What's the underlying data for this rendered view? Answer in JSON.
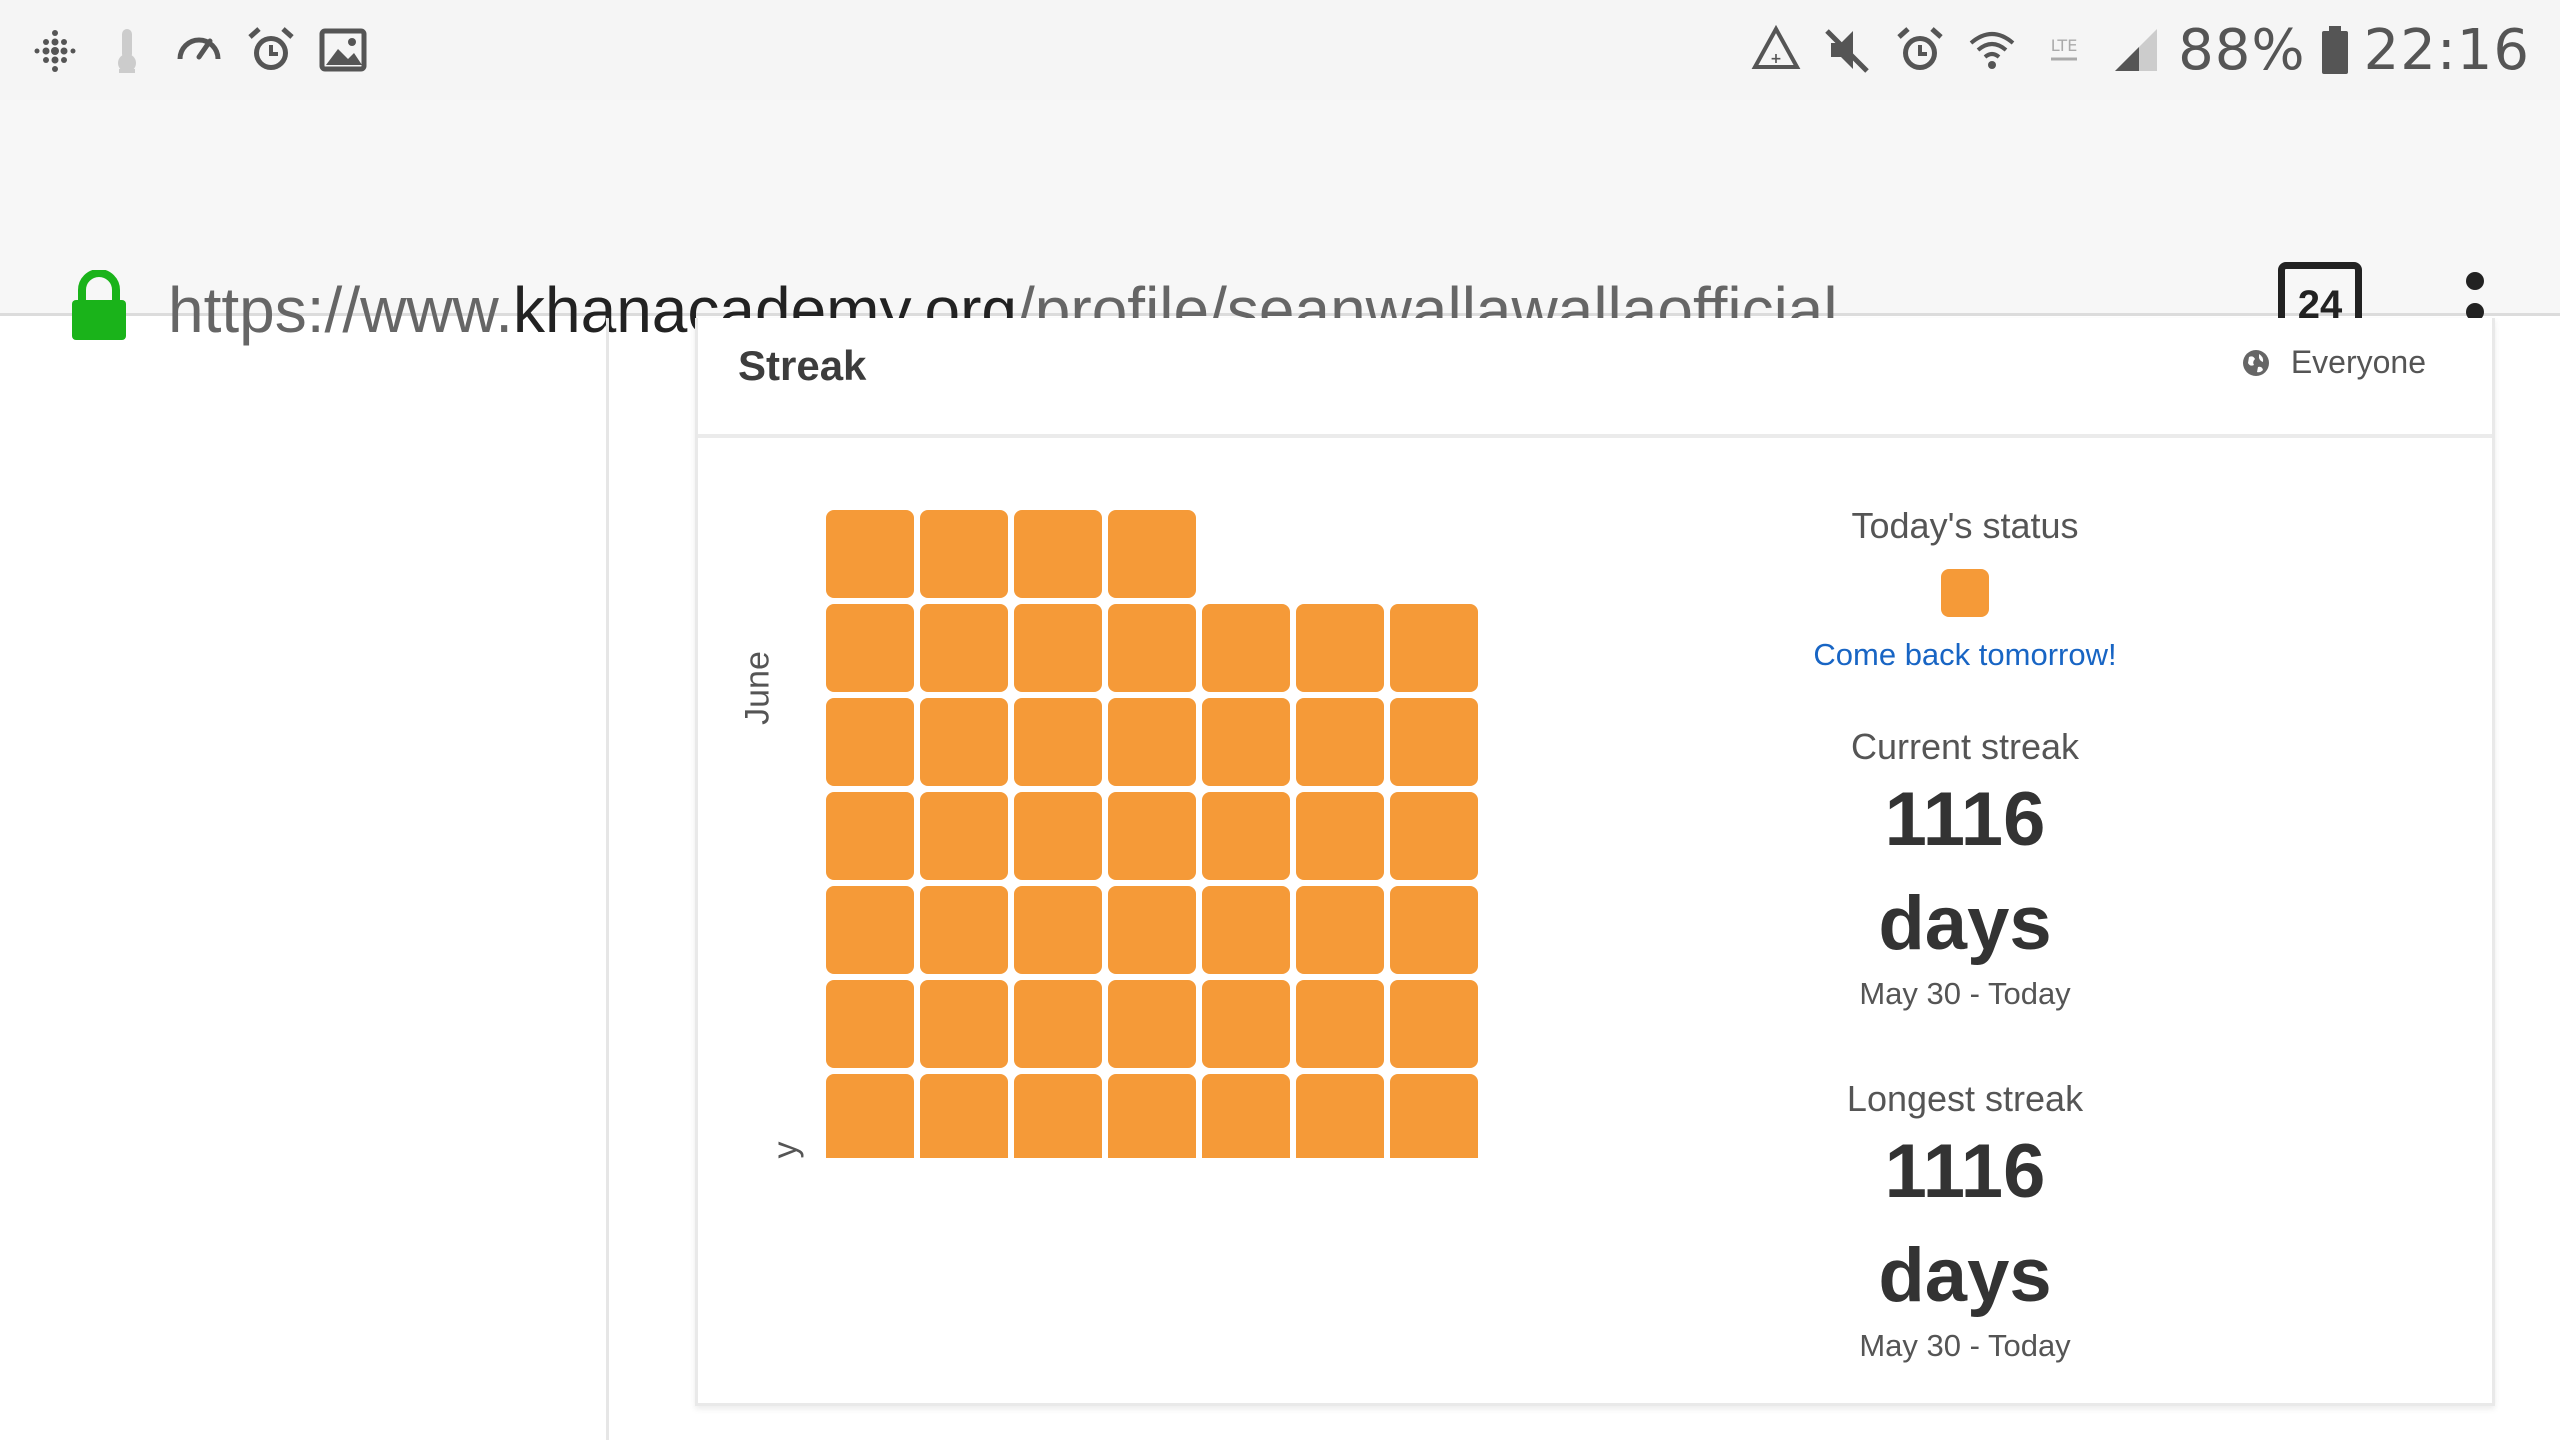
{
  "status_bar": {
    "left_icons": [
      "fitbit-icon",
      "thermometer-icon",
      "speedometer-icon",
      "alarm-icon",
      "gallery-icon"
    ],
    "right_icons": [
      "data-saver-icon",
      "mute-icon",
      "alarm-icon",
      "wifi-icon",
      "lte-icon",
      "signal-icon"
    ],
    "battery_percent": "88%",
    "time": "22:16"
  },
  "browser": {
    "url_prefix": "https://www.",
    "url_host": "khanacademy.org",
    "url_path": "/profile/seanwallawallaofficial",
    "tab_count": "24",
    "lock_color": "#1ab31a"
  },
  "streak_card": {
    "title": "Streak",
    "visibility": "Everyone",
    "month_labels": [
      "June",
      "y"
    ],
    "cell_color": "#f59a38",
    "grid_rows": [
      4,
      7,
      7,
      7,
      7,
      7,
      7
    ],
    "today_status_label": "Today's status",
    "today_status_color": "#f59a38",
    "come_back": "Come back tomorrow!",
    "current_streak_label": "Current streak",
    "current_streak_value": "1116",
    "current_streak_unit": "days",
    "current_streak_range": "May 30 - Today",
    "longest_streak_label": "Longest streak",
    "longest_streak_value": "1116",
    "longest_streak_unit": "days",
    "longest_streak_range": "May 30 - Today"
  }
}
